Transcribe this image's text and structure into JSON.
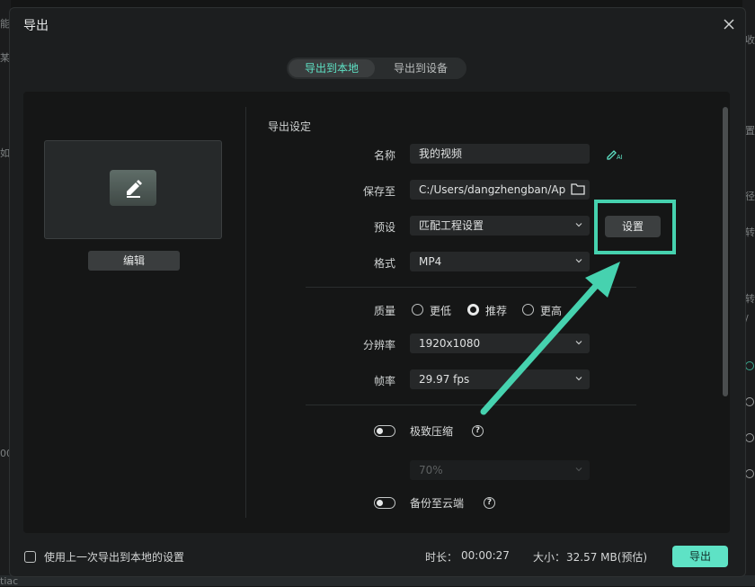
{
  "background": {
    "left_chars": [
      "能",
      "某",
      "如",
      "00"
    ],
    "right_chars": [
      "收",
      "置",
      "径",
      "转",
      "转",
      "/"
    ],
    "bottom_left": "tiac"
  },
  "dialog": {
    "title": "导出",
    "tabs": [
      {
        "label": "导出到本地",
        "active": true
      },
      {
        "label": "导出到设备",
        "active": false
      }
    ]
  },
  "preview": {
    "edit_button_label": "编辑"
  },
  "settings": {
    "section_title": "导出设定",
    "name": {
      "label": "名称",
      "value": "我的视频"
    },
    "save_to": {
      "label": "保存至",
      "value": "C:/Users/dangzhengban/Ap"
    },
    "preset": {
      "label": "预设",
      "value": "匹配工程设置",
      "button": "设置"
    },
    "format": {
      "label": "格式",
      "value": "MP4"
    },
    "quality": {
      "label": "质量",
      "options": [
        {
          "label": "更低",
          "selected": false
        },
        {
          "label": "推荐",
          "selected": true
        },
        {
          "label": "更高",
          "selected": false
        }
      ]
    },
    "resolution": {
      "label": "分辨率",
      "value": "1920x1080"
    },
    "framerate": {
      "label": "帧率",
      "value": "29.97 fps"
    },
    "extreme_compress": {
      "label": "极致压缩",
      "enabled": false,
      "level": "70%"
    },
    "cloud_backup": {
      "label": "备份至云端",
      "enabled": false
    }
  },
  "footer": {
    "remember_label": "使用上一次导出到本地的设置",
    "duration_label": "时长：",
    "duration_value": "00:00:27",
    "size_label": "大小：",
    "size_value": "32.57 MB(预估)",
    "export_label": "导出"
  },
  "colors": {
    "accent": "#5ee2c5",
    "highlight": "#46d2af"
  }
}
